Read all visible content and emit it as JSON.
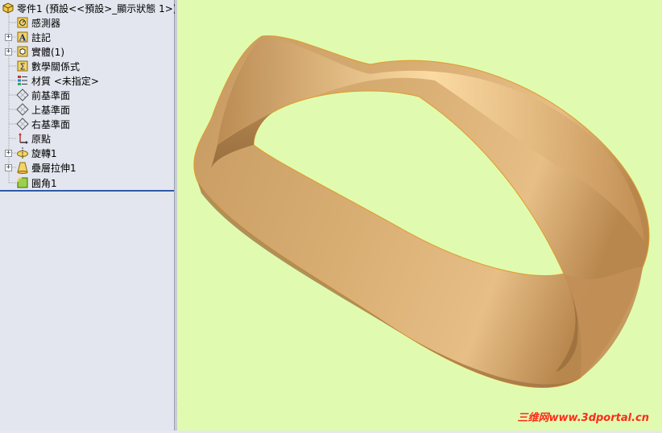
{
  "tree": {
    "root": {
      "label": "零件1 (預設<<預設>_顯示狀態 1>)"
    },
    "items": [
      {
        "label": "感測器"
      },
      {
        "label": "註記"
      },
      {
        "label": "實體(1)"
      },
      {
        "label": "數學關係式"
      },
      {
        "label": "材質 <未指定>"
      },
      {
        "label": "前基準面"
      },
      {
        "label": "上基準面"
      },
      {
        "label": "右基準面"
      },
      {
        "label": "原點"
      },
      {
        "label": "旋轉1"
      },
      {
        "label": "疊層拉伸1"
      },
      {
        "label": "圓角1"
      }
    ]
  },
  "watermark": {
    "text": "三维网www.3dportal.cn"
  },
  "colors": {
    "viewport_bg": "#e0fbb0",
    "model": "#d9a96a",
    "selection_line": "#2f5aa8"
  }
}
